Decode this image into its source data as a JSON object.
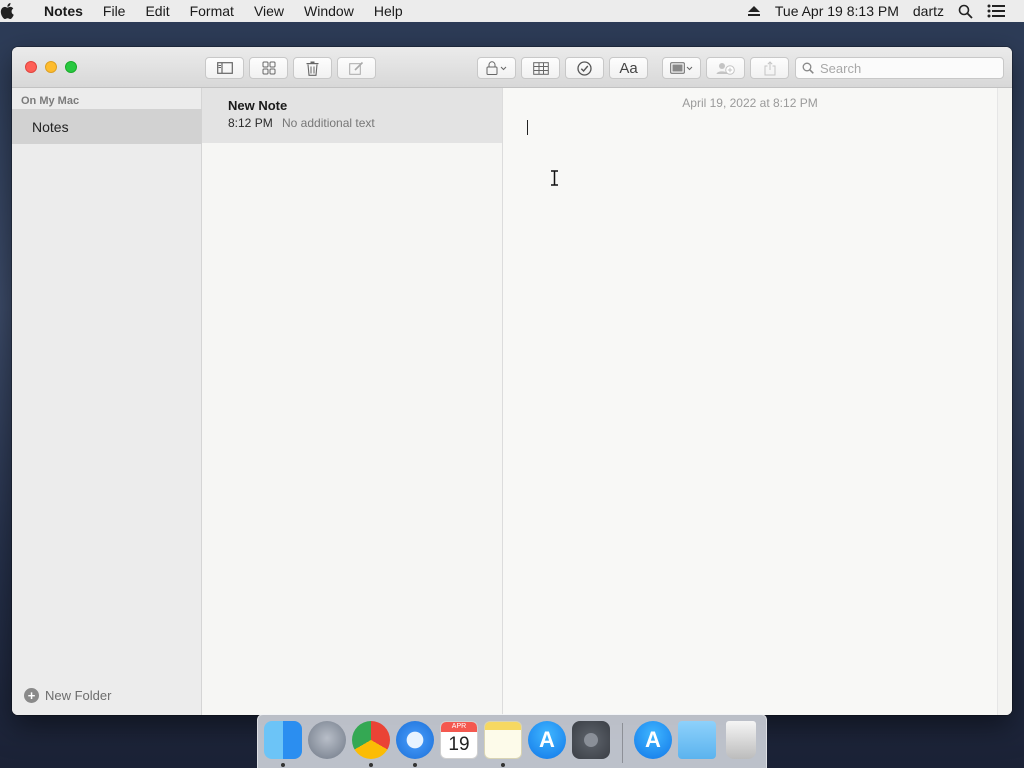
{
  "menubar": {
    "app_name": "Notes",
    "menus": [
      "File",
      "Edit",
      "Format",
      "View",
      "Window",
      "Help"
    ],
    "clock": "Tue Apr 19  8:13 PM",
    "user": "dartz"
  },
  "toolbar": {
    "search_placeholder": "Search"
  },
  "sidebar": {
    "section": "On My Mac",
    "folder": "Notes",
    "new_folder": "New Folder"
  },
  "notes": [
    {
      "title": "New Note",
      "time": "8:12 PM",
      "preview": "No additional text"
    }
  ],
  "editor": {
    "date": "April 19, 2022 at 8:12 PM"
  },
  "dock": {
    "calendar_month": "APR",
    "calendar_day": "19",
    "apps": [
      "finder-icon",
      "launchpad-icon",
      "chrome-icon",
      "safari-icon",
      "calendar-icon",
      "notes-icon",
      "app-store-icon",
      "system-preferences-icon",
      "downloads-folder-icon",
      "trash-icon"
    ]
  },
  "colors": {
    "close": "#fe5f57",
    "minimize": "#febc2e",
    "maximize": "#28c840",
    "selected_row": "#e3e3e3"
  }
}
